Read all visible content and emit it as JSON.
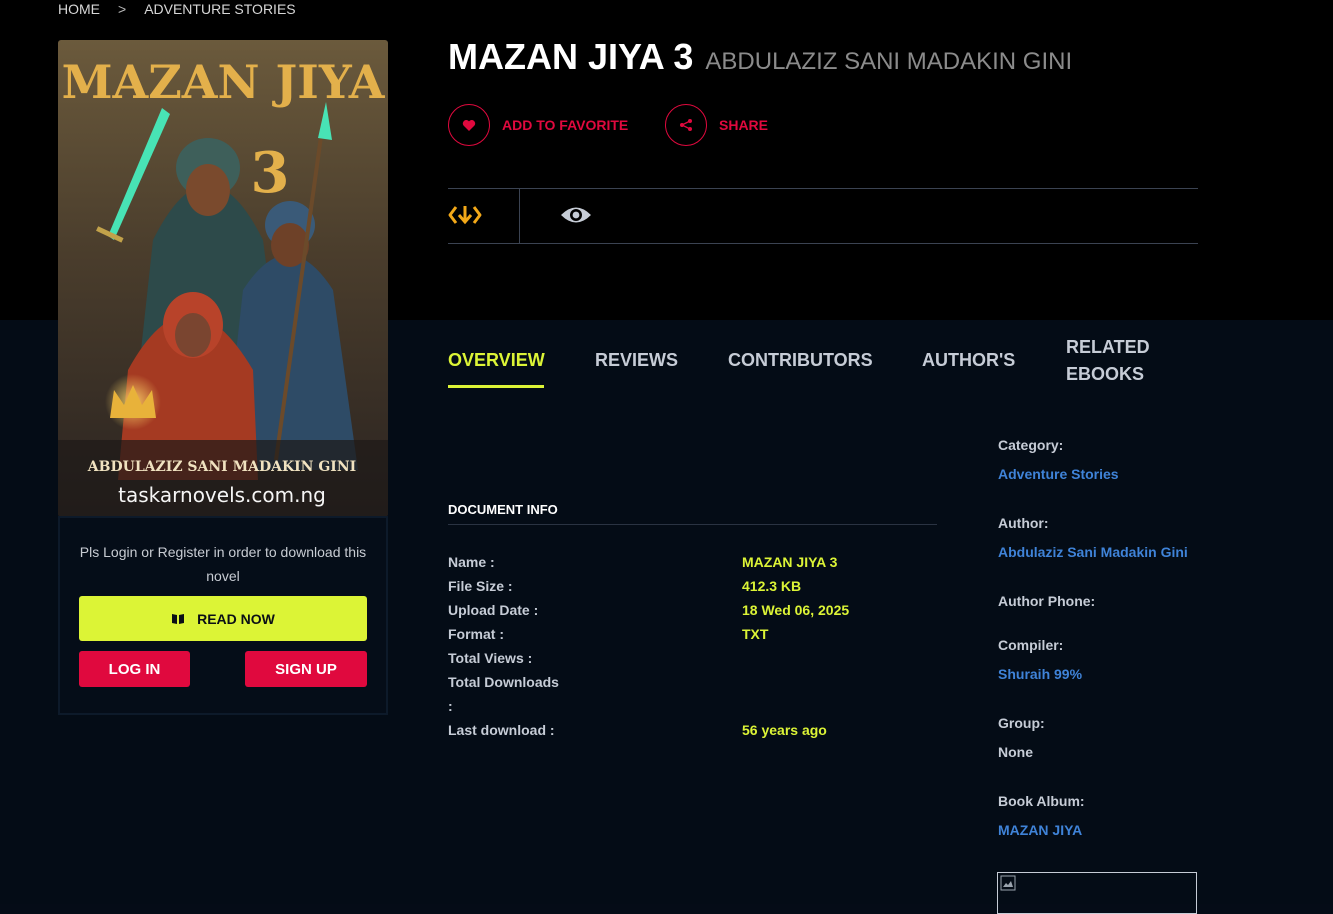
{
  "breadcrumb": {
    "home": "HOME",
    "separator": ">",
    "current": "ADVENTURE STORIES"
  },
  "book": {
    "title": "MAZAN JIYA 3",
    "author": "ABDULAZIZ SANI MADAKIN GINI"
  },
  "cover": {
    "title": "MAZAN JIYA",
    "number": "3",
    "author": "ABDULAZIZ SANI MADAKIN GINI",
    "website": "taskarnovels.com.ng"
  },
  "actions": {
    "favorite": "ADD TO FAVORITE",
    "share": "SHARE"
  },
  "stats": {
    "download_icon": "download-arrows-icon",
    "views_icon": "eye-icon"
  },
  "login_box": {
    "message": "Pls Login or Register in order to download this novel",
    "read_now": "READ NOW",
    "login": "LOG IN",
    "signup": "SIGN UP"
  },
  "tabs": [
    "OVERVIEW",
    "REVIEWS",
    "CONTRIBUTORS",
    "AUTHOR'S",
    "RELATED",
    "EBOOKS"
  ],
  "document_info": {
    "heading": "DOCUMENT INFO",
    "rows": [
      {
        "label": "Name :",
        "value": "MAZAN JIYA 3"
      },
      {
        "label": "File Size :",
        "value": "412.3 KB"
      },
      {
        "label": "Upload Date :",
        "value": "18 Wed 06, 2025"
      },
      {
        "label": "Format :",
        "value": "TXT"
      },
      {
        "label": "Total Views :",
        "value": ""
      },
      {
        "label": "Total Downloads",
        "value": ""
      },
      {
        "label": ":",
        "value": ""
      },
      {
        "label": "Last download :",
        "value": "56 years ago"
      }
    ]
  },
  "sidebar": {
    "category_label": "Category:",
    "category_value": "Adventure Stories",
    "author_label": "Author:",
    "author_value": "Abdulaziz Sani Madakin Gini",
    "phone_label": "Author Phone:",
    "compiler_label": "Compiler:",
    "compiler_value": "Shuraih 99%",
    "group_label": "Group:",
    "group_value": "None",
    "album_label": "Book Album:",
    "album_value": "MAZAN JIYA"
  },
  "colors": {
    "accent": "#dcf436",
    "brand_red": "#e0093e",
    "link": "#3f83d8",
    "background": "#050c17"
  }
}
